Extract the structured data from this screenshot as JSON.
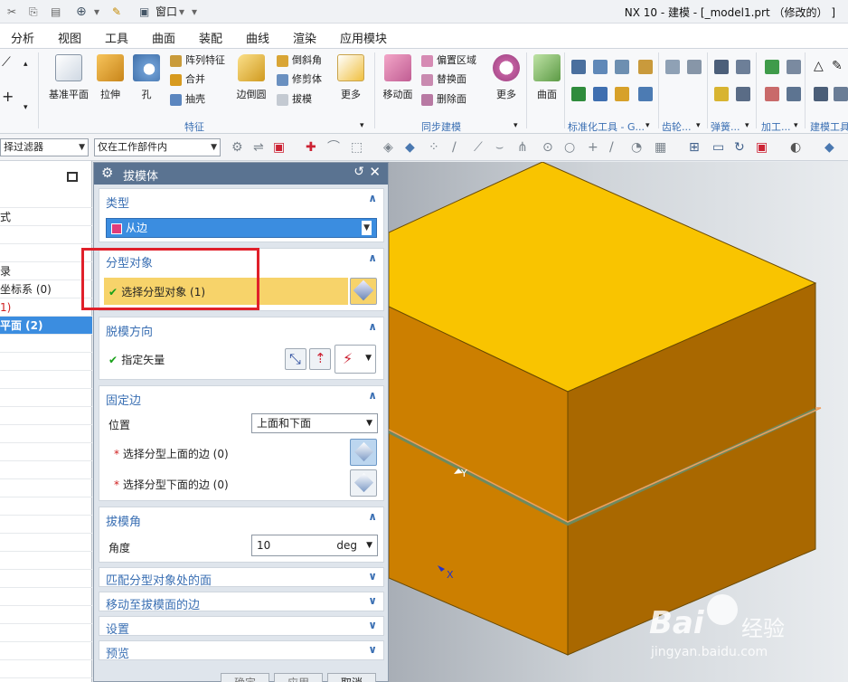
{
  "window": {
    "title": "NX 10 - 建模 - [_model1.prt （修改的） ]",
    "window_menu_label": "窗口"
  },
  "menubar": {
    "items": [
      "分析",
      "视图",
      "工具",
      "曲面",
      "装配",
      "曲线",
      "渲染",
      "应用模块"
    ]
  },
  "ribbon": {
    "datum_plane": "基准平面",
    "extrude": "拉伸",
    "hole": "孔",
    "pattern_feature": "阵列特征",
    "unite": "合并",
    "shell": "抽壳",
    "edge_blend": "边倒圆",
    "chamfer": "倒斜角",
    "trim_body": "修剪体",
    "draft": "拔模",
    "more1": "更多",
    "move_face": "移动面",
    "offset_region": "偏置区域",
    "replace_face": "替换面",
    "delete_face": "删除面",
    "more2": "更多",
    "surface": "曲面",
    "group_feature": "特征",
    "group_sync": "同步建模",
    "group_std": "标准化工具 - G...",
    "group_gear": "齿轮...",
    "group_spring": "弹簧...",
    "group_machining": "加工...",
    "group_build": "建模工具..."
  },
  "selection_bar": {
    "filter": "择过滤器",
    "scope": "仅在工作部件内"
  },
  "navigator": {
    "rows": [
      {
        "text": "",
        "selected": false,
        "color": ""
      },
      {
        "text": "式",
        "selected": false,
        "color": ""
      },
      {
        "text": "",
        "selected": false,
        "color": ""
      },
      {
        "text": "",
        "selected": false,
        "color": ""
      },
      {
        "text": "录",
        "selected": false,
        "color": ""
      },
      {
        "text": "坐标系 (0)",
        "selected": false,
        "color": ""
      },
      {
        "text": "1)",
        "selected": false,
        "color": "#d02020"
      },
      {
        "text": "平面 (2)",
        "selected": true,
        "color": ""
      }
    ]
  },
  "dialog": {
    "title": "拔模体",
    "type_section": {
      "title": "类型",
      "value": "从边"
    },
    "parting_section": {
      "title": "分型对象",
      "select_label": "选择分型对象 (1)"
    },
    "draw_section": {
      "title": "脱模方向",
      "vector_label": "指定矢量"
    },
    "fixed_section": {
      "title": "固定边",
      "position_label": "位置",
      "position_value": "上面和下面",
      "upper_edges": "选择分型上面的边 (0)",
      "lower_edges": "选择分型下面的边 (0)"
    },
    "angle_section": {
      "title": "拔模角",
      "angle_label": "角度",
      "angle_value": "10",
      "unit": "deg"
    },
    "collapsed": [
      "匹配分型对象处的面",
      "移动至拔模面的边",
      "设置",
      "预览"
    ],
    "footer": {
      "ok": "确定",
      "apply": "应用",
      "cancel": "取消"
    }
  },
  "viewport": {
    "axis_y": "Y",
    "axis_x": "X",
    "watermark_brand": "Bai",
    "watermark_text": "经验",
    "watermark_url": "jingyan.baidu.com"
  },
  "colors": {
    "top_face": "#f9c400",
    "front_face": "#cc7f00",
    "side_face": "#a96800",
    "parting_line": "#f0a060",
    "dialog_header": "#5a7391",
    "highlight_row": "#f7d36a",
    "annotation_box": "#e0202a"
  }
}
